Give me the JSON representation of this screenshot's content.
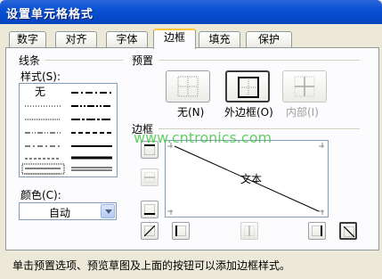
{
  "window": {
    "title": "设置单元格格式"
  },
  "tabs": [
    {
      "label": "数字"
    },
    {
      "label": "对齐"
    },
    {
      "label": "字体"
    },
    {
      "label": "边框"
    },
    {
      "label": "填充"
    },
    {
      "label": "保护"
    }
  ],
  "active_tab": "边框",
  "line": {
    "group_label": "线条",
    "style_label": "样式(S):",
    "none_label": "无",
    "color_label": "颜色(C):",
    "color_value": "自动"
  },
  "presets": {
    "group_label": "预置",
    "items": [
      {
        "label": "无(N)"
      },
      {
        "label": "外边框(O)"
      },
      {
        "label": "内部(I)"
      }
    ]
  },
  "border": {
    "group_label": "边框",
    "preview_text": "文本"
  },
  "watermark": "www.cntronics.com",
  "status_text": "单击预置选项、预览草图及上面的按钮可以添加边框样式。",
  "colors": {
    "titlebar": "#0a52d6",
    "tab_highlight": "#ffc83c",
    "watermark": "#3fc43f"
  }
}
